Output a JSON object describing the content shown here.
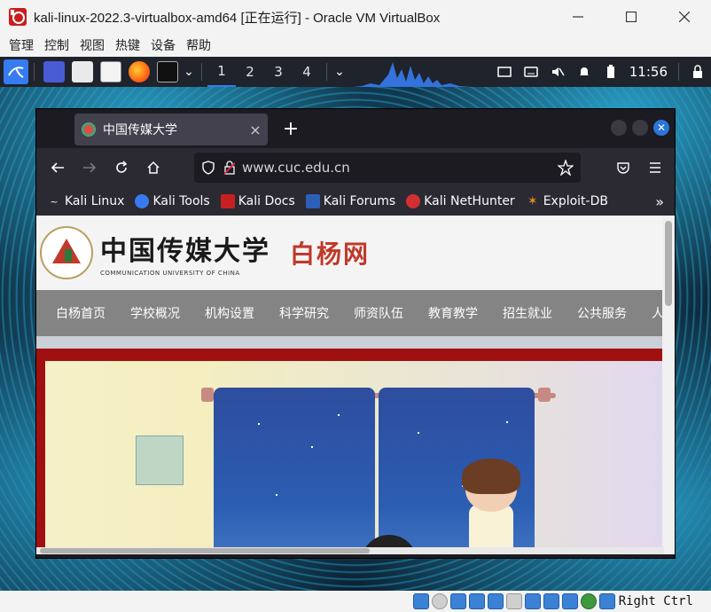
{
  "window": {
    "title": "kali-linux-2022.3-virtualbox-amd64 [正在运行] - Oracle VM VirtualBox",
    "controls": [
      "minimize",
      "maximize",
      "close"
    ]
  },
  "menubar": {
    "items": [
      "管理",
      "控制",
      "视图",
      "热键",
      "设备",
      "帮助"
    ]
  },
  "kali_panel": {
    "workspaces": [
      "1",
      "2",
      "3",
      "4"
    ],
    "active_workspace": "1",
    "clock": "11:56",
    "graph_color": "#367bf0"
  },
  "firefox": {
    "tab": {
      "title": "中国传媒大学",
      "close": "×"
    },
    "new_tab": "+",
    "url": "www.cuc.edu.cn",
    "bookmarks": [
      {
        "label": "Kali Linux",
        "icon": "kali-dragon-icon"
      },
      {
        "label": "Kali Tools",
        "icon": "kali-tools-icon"
      },
      {
        "label": "Kali Docs",
        "icon": "kali-docs-icon"
      },
      {
        "label": "Kali Forums",
        "icon": "kali-forums-icon"
      },
      {
        "label": "Kali NetHunter",
        "icon": "nethunter-icon"
      },
      {
        "label": "Exploit-DB",
        "icon": "exploit-db-icon"
      }
    ],
    "bookmarks_more": "»"
  },
  "site": {
    "logo_cn": "中国传媒大学",
    "logo_en": "COMMUNICATION UNIVERSITY OF CHINA",
    "site_name": "白杨网",
    "nav": [
      "白杨首页",
      "学校概况",
      "机构设置",
      "科学研究",
      "师资队伍",
      "教育教学",
      "招生就业",
      "公共服务",
      "人"
    ],
    "accent_color": "#a11010"
  },
  "statusbar": {
    "host_key": "Right Ctrl"
  }
}
